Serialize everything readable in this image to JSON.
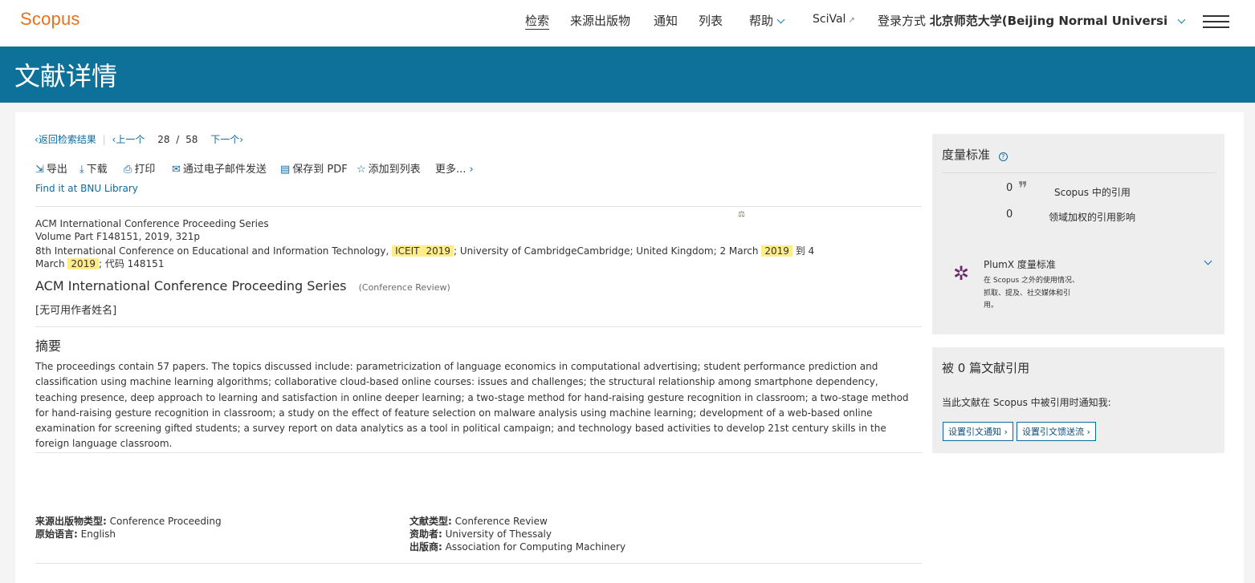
{
  "header": {
    "logo": "Scopus",
    "nav": {
      "search": "检索",
      "sources": "来源出版物",
      "alerts": "通知",
      "lists": "列表",
      "help": "帮助",
      "scival": "SciVal",
      "login_prefix": "登录方式",
      "institution": "北京师范大学(Beijing Normal Universi"
    }
  },
  "banner": {
    "title": "文献详情"
  },
  "result_nav": {
    "back": "返回检索结果",
    "prev": "上一个",
    "current": "28",
    "separator": "/",
    "total": "58",
    "next": "下一个"
  },
  "toolbar": {
    "export": "导出",
    "download": "下载",
    "print": "打印",
    "email": "通过电子邮件发送",
    "save_pdf": "保存到 PDF",
    "add_list": "添加到列表",
    "more": "更多..."
  },
  "library_link": "Find it at BNU Library",
  "source": {
    "series": "ACM International Conference Proceeding Series",
    "volume": "Volume Part F148151, 2019, 321p",
    "conf_prefix": "8th International Conference on Educational and Information Technology,",
    "conf_hl1": "ICEIT",
    "conf_hl2": "2019",
    "conf_mid": "; University of CambridgeCambridge; United Kingdom; 2 March",
    "conf_hl3": "2019",
    "conf_end": "到 4",
    "line4_prefix": "March",
    "line4_hl": "2019",
    "line4_suffix": "; 代码 148151"
  },
  "document": {
    "title": "ACM International Conference Proceeding Series",
    "type_note": "(Conference Review)",
    "authors": "[无可用作者姓名]"
  },
  "abstract": {
    "heading": "摘要",
    "text": "The proceedings contain 57 papers. The topics discussed include: parametricization of language economics in computational advertising; student performance prediction and classification using machine learning algorithms; collaborative cloud-based online courses: issues and challenges; the structural relationship among smartphone dependency, teaching presence, deep approach to learning and satisfaction in online deeper learning; a two-stage method for hand-raising gesture recognition in classroom; a two-stage method for hand-raising gesture recognition in classroom; a study on the effect of feature selection on malware analysis using machine learning; development of a web-based online examination for screening gifted students; a survey report on data analytics as a tool in political campaign; and technology based activities to develop 21st century skills in the foreign language classroom."
  },
  "details": {
    "source_type_label": "来源出版物类型:",
    "source_type": "Conference Proceeding",
    "language_label": "原始语言:",
    "language": "English",
    "doc_type_label": "文献类型:",
    "doc_type": "Conference Review",
    "sponsor_label": "资助者:",
    "sponsor": "University of Thessaly",
    "publisher_label": "出版商:",
    "publisher": "Association for Computing Machinery"
  },
  "metrics": {
    "heading": "度量标准",
    "citations_value": "0",
    "citations_label": "Scopus 中的引用",
    "fwci_value": "0",
    "fwci_label": "领域加权的引用影响",
    "plumx_title": "PlumX 度量标准",
    "plumx_desc_1": "在 Scopus 之外的使用情况、",
    "plumx_desc_2": "抓取、提及、社交媒体和引",
    "plumx_desc_3": "用。"
  },
  "cited_by": {
    "heading": "被 0 篇文献引用",
    "notify": "当此文献在 Scopus 中被引用时通知我:",
    "alert_btn": "设置引文通知",
    "feed_btn": "设置引文馈送流"
  },
  "colors": {
    "brand": "#e9711c",
    "banner": "#0d7199",
    "link": "#0d6aa0",
    "highlight": "#fdec8c",
    "plumx": "#6c2a6a"
  }
}
